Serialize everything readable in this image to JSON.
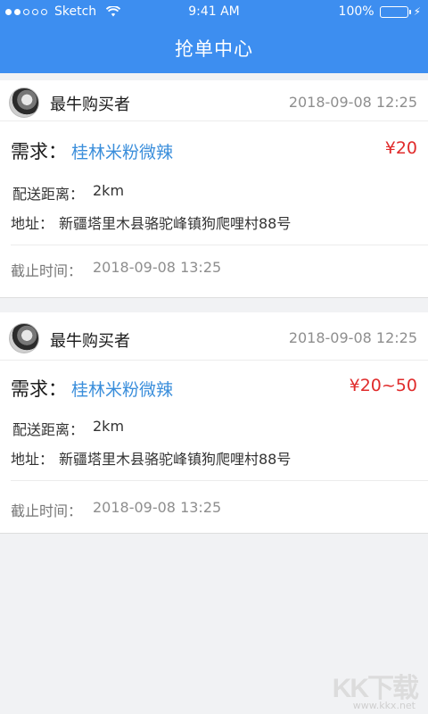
{
  "status_bar": {
    "carrier": "Sketch",
    "time": "9:41 AM",
    "battery": "100%",
    "battery_level": 1.0,
    "signal_bars_filled": 2,
    "signal_bars_total": 5
  },
  "nav": {
    "title": "抢单中心"
  },
  "orders": [
    {
      "buyer": "最牛购买者",
      "posted_time": "2018-09-08 12:25",
      "demand_label": "需求：",
      "demand": "桂林米粉微辣",
      "price": "¥20",
      "distance_label": "配送距离：",
      "distance": "2km",
      "address_label": "地址：",
      "address": "新疆塔里木县骆驼峰镇狗爬哩村88号",
      "deadline_label": "截止时间：",
      "deadline": "2018-09-08 13:25"
    },
    {
      "buyer": "最牛购买者",
      "posted_time": "2018-09-08 12:25",
      "demand_label": "需求：",
      "demand": "桂林米粉微辣",
      "price": "¥20~50",
      "distance_label": "配送距离：",
      "distance": "2km",
      "address_label": "地址：",
      "address": "新疆塔里木县骆驼峰镇狗爬哩村88号",
      "deadline_label": "截止时间：",
      "deadline": "2018-09-08 13:25"
    }
  ],
  "watermark": {
    "logo": "KK下载",
    "url": "www.kkx.net"
  },
  "colors": {
    "primary": "#3d8ef0",
    "price": "#e02b2b",
    "demand": "#3a8edb"
  }
}
